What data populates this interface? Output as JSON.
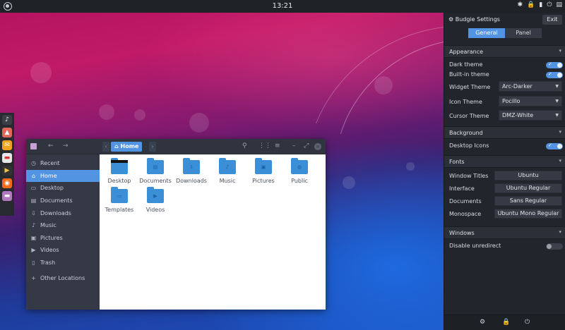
{
  "top_panel": {
    "clock": "13:21",
    "tray": [
      "✱",
      "🔒",
      "▮",
      "⏻",
      "▤"
    ]
  },
  "dock": {
    "apps": [
      {
        "name": "rhythmbox",
        "glyph": "♪",
        "color": "#3a3f46"
      },
      {
        "name": "photos",
        "glyph": "▲",
        "color": "#e2665a"
      },
      {
        "name": "mail",
        "glyph": "✉",
        "color": "#f0a31c"
      },
      {
        "name": "calendar",
        "glyph": "▬",
        "color": "#e8e8e8"
      },
      {
        "name": "videos",
        "glyph": "▶",
        "color": "#333"
      },
      {
        "name": "firefox",
        "glyph": "◉",
        "color": "#f26b1d"
      },
      {
        "name": "files",
        "glyph": "▬",
        "color": "#b179c0"
      }
    ]
  },
  "file_manager": {
    "breadcrumb": "Home",
    "sidebar": [
      {
        "label": "Recent",
        "icon": "◷",
        "active": false
      },
      {
        "label": "Home",
        "icon": "⌂",
        "active": true
      },
      {
        "label": "Desktop",
        "icon": "▭",
        "active": false
      },
      {
        "label": "Documents",
        "icon": "▤",
        "active": false
      },
      {
        "label": "Downloads",
        "icon": "⇩",
        "active": false
      },
      {
        "label": "Music",
        "icon": "♪",
        "active": false
      },
      {
        "label": "Pictures",
        "icon": "▣",
        "active": false
      },
      {
        "label": "Videos",
        "icon": "▶",
        "active": false
      },
      {
        "label": "Trash",
        "icon": "▯",
        "active": false
      },
      {
        "label": "Other Locations",
        "icon": "+",
        "active": false
      }
    ],
    "folders": [
      {
        "label": "Desktop",
        "glyph": ""
      },
      {
        "label": "Documents",
        "glyph": "▤"
      },
      {
        "label": "Downloads",
        "glyph": "⇩"
      },
      {
        "label": "Music",
        "glyph": "♪"
      },
      {
        "label": "Pictures",
        "glyph": "▣"
      },
      {
        "label": "Public",
        "glyph": "◍"
      },
      {
        "label": "Templates",
        "glyph": "▭"
      },
      {
        "label": "Videos",
        "glyph": "▶"
      }
    ]
  },
  "settings": {
    "title": "Budgie Settings",
    "exit_label": "Exit",
    "tabs": {
      "general": "General",
      "panel": "Panel"
    },
    "sections": {
      "appearance": "Appearance",
      "background": "Background",
      "fonts": "Fonts",
      "windows": "Windows"
    },
    "appearance": {
      "dark_theme": {
        "label": "Dark theme",
        "on": true
      },
      "builtin_theme": {
        "label": "Built-in theme",
        "on": true
      },
      "widget_theme": {
        "label": "Widget Theme",
        "value": "Arc-Darker"
      },
      "icon_theme": {
        "label": "Icon Theme",
        "value": "Pocillo"
      },
      "cursor_theme": {
        "label": "Cursor Theme",
        "value": "DMZ-White"
      }
    },
    "background": {
      "desktop_icons": {
        "label": "Desktop Icons",
        "on": true
      }
    },
    "fonts": {
      "window_titles": {
        "label": "Window Titles",
        "value": "Ubuntu"
      },
      "interface": {
        "label": "Interface",
        "value": "Ubuntu Regular"
      },
      "documents": {
        "label": "Documents",
        "value": "Sans Regular"
      },
      "monospace": {
        "label": "Monospace",
        "value": "Ubuntu Mono Regular"
      }
    },
    "windows": {
      "disable_unredirect": {
        "label": "Disable unredirect",
        "on": false
      }
    },
    "footer_icons": [
      "⚙",
      "🔒",
      "⏻"
    ]
  }
}
